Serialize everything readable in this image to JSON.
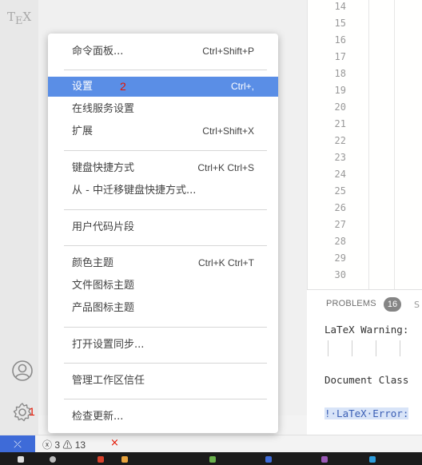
{
  "activity_bar": {
    "tex_label_t": "T",
    "tex_label_e": "E",
    "tex_label_x": "X",
    "settings_badge": "1"
  },
  "editor": {
    "line_numbers": [
      "14",
      "15",
      "16",
      "17",
      "18",
      "19",
      "20",
      "21",
      "22",
      "23",
      "24",
      "25",
      "26",
      "27",
      "28",
      "29",
      "30"
    ]
  },
  "panel": {
    "problems_label": "PROBLEMS",
    "problems_count": "16",
    "tab_partial": "S",
    "output_lines": [
      "LaTeX Warning:",
      "Document Class",
      "!·LaTeX·Error:"
    ]
  },
  "statusbar": {
    "remote_icon": "⤫",
    "error_count": "3",
    "warning_count": "13",
    "close_icon": "×"
  },
  "menu": {
    "items": [
      {
        "label": "命令面板...",
        "shortcut": "Ctrl+Shift+P"
      },
      {
        "label": "设置",
        "shortcut": "Ctrl+,",
        "annotation": "2"
      },
      {
        "label": "在线服务设置",
        "shortcut": ""
      },
      {
        "label": "扩展",
        "shortcut": "Ctrl+Shift+X"
      },
      {
        "label": "键盘快捷方式",
        "shortcut": "Ctrl+K Ctrl+S"
      },
      {
        "label": "从 - 中迁移键盘快捷方式...",
        "shortcut": ""
      },
      {
        "label": "用户代码片段",
        "shortcut": ""
      },
      {
        "label": "颜色主题",
        "shortcut": "Ctrl+K Ctrl+T"
      },
      {
        "label": "文件图标主题",
        "shortcut": ""
      },
      {
        "label": "产品图标主题",
        "shortcut": ""
      },
      {
        "label": "打开设置同步...",
        "shortcut": ""
      },
      {
        "label": "管理工作区信任",
        "shortcut": ""
      },
      {
        "label": "检查更新...",
        "shortcut": ""
      }
    ]
  },
  "colors": {
    "accent": "#5a8ee6",
    "status_remote": "#3e6bd8",
    "error_red": "#e51400"
  }
}
